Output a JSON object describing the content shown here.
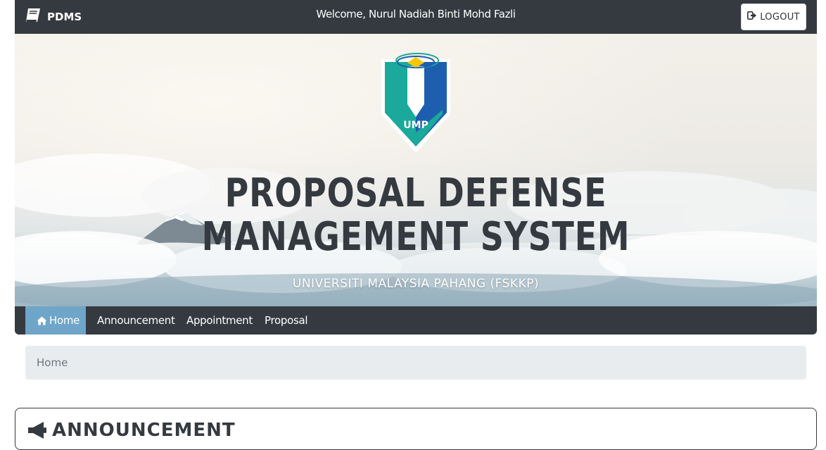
{
  "header": {
    "brand": "PDMS",
    "brand_icon": "book-icon",
    "welcome": "Welcome, Nurul Nadiah Binti Mohd Fazli",
    "logout_label": "LOGOUT",
    "logout_icon": "sign-out-icon"
  },
  "hero": {
    "logo_text": "UMP",
    "title_line1": "PROPOSAL DEFENSE",
    "title_line2": "MANAGEMENT SYSTEM",
    "subtitle": "UNIVERSITI MALAYSIA PAHANG (FSKKP)"
  },
  "nav": {
    "items": [
      {
        "label": "Home",
        "icon": "home-icon",
        "active": true
      },
      {
        "label": "Announcement",
        "active": false
      },
      {
        "label": "Appointment",
        "active": false
      },
      {
        "label": "Proposal",
        "active": false
      }
    ]
  },
  "breadcrumb": {
    "current": "Home"
  },
  "announcement": {
    "title": "ANNOUNCEMENT",
    "icon": "megaphone-icon"
  },
  "colors": {
    "dark": "#343a40",
    "active_nav": "#6fa5c8",
    "breadcrumb_bg": "#e9ecef",
    "logo_teal": "#1aa99a",
    "logo_blue": "#1d5fae",
    "logo_yellow": "#f6c800"
  }
}
